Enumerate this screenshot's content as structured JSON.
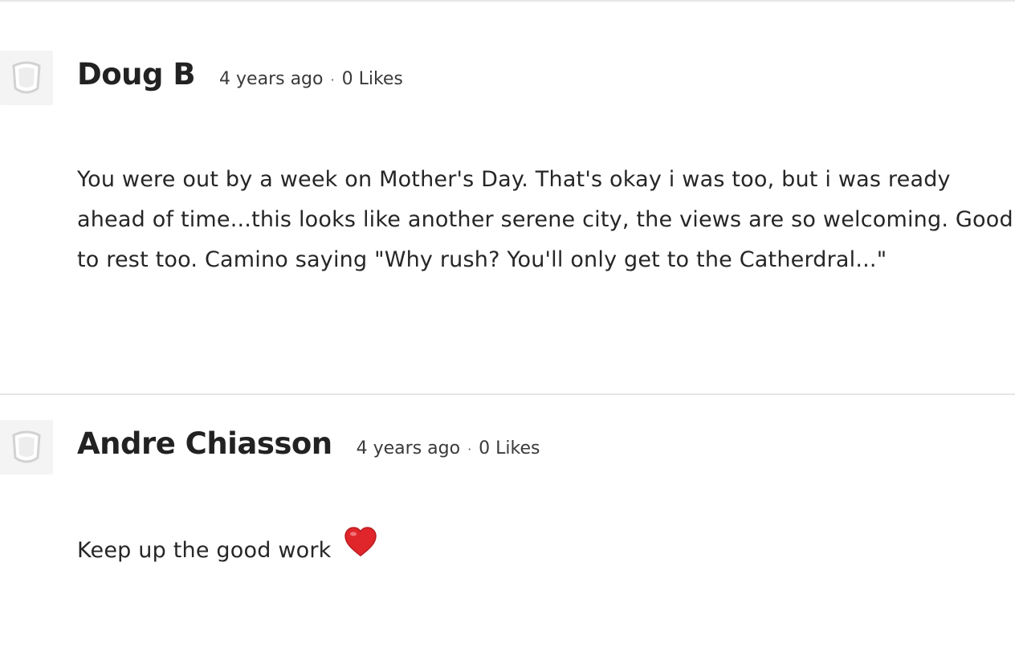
{
  "comments": [
    {
      "author": "Doug B",
      "time": "4 years ago",
      "separator": "·",
      "likes": "0 Likes",
      "avatar_icon": "default-avatar-icon",
      "body": "You were out by a week on Mother's Day. That's okay i was too, but i was ready ahead of time...this looks like another serene city, the views are so welcoming. Good to rest too. Camino saying \"Why rush? You'll only get to the Catherdral...\""
    },
    {
      "author": "Andre Chiasson",
      "time": "4 years ago",
      "separator": "·",
      "likes": "0 Likes",
      "avatar_icon": "default-avatar-icon",
      "body": "Keep up the good work",
      "emoji_icon": "red-heart-icon"
    }
  ],
  "colors": {
    "divider": "#e6e6e6",
    "avatar_bg": "#f4f4f4",
    "heart": "#e0262b",
    "text": "#262626"
  }
}
